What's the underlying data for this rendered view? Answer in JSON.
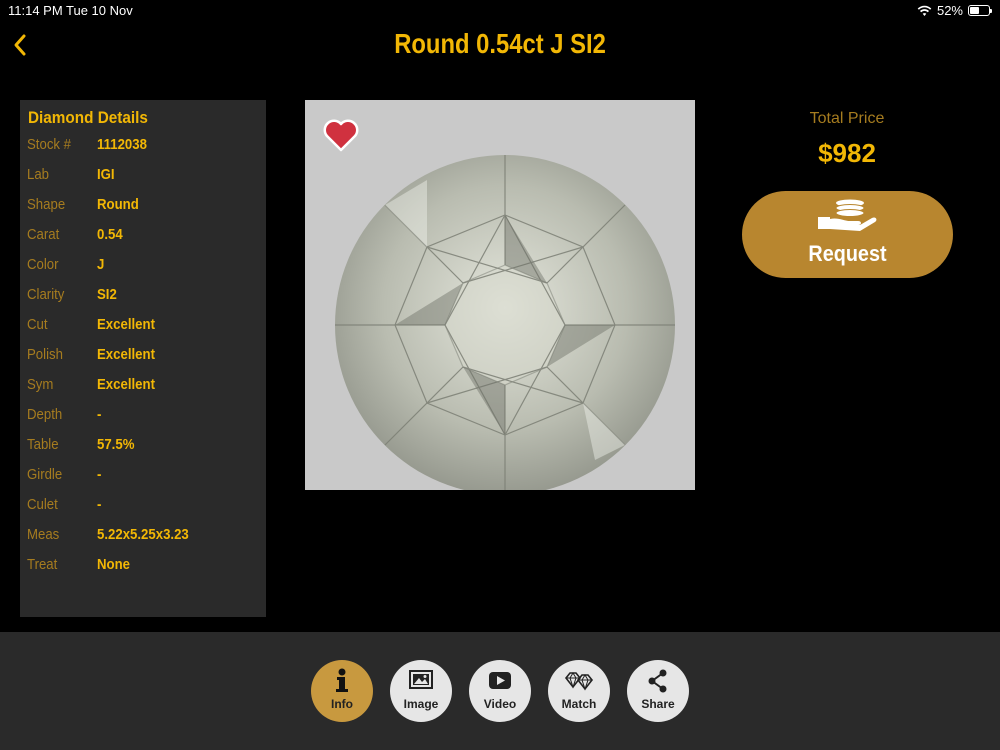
{
  "status_bar": {
    "time": "11:14 PM",
    "date": "Tue 10 Nov",
    "battery": "52%"
  },
  "header": {
    "title": "Round 0.54ct J SI2",
    "back_icon": "chevron-left-icon"
  },
  "details": {
    "title": "Diamond Details",
    "rows": [
      {
        "label": "Stock #",
        "value": "1112038"
      },
      {
        "label": "Lab",
        "value": "IGI"
      },
      {
        "label": "Shape",
        "value": "Round"
      },
      {
        "label": "Carat",
        "value": "0.54"
      },
      {
        "label": "Color",
        "value": "J"
      },
      {
        "label": "Clarity",
        "value": "SI2"
      },
      {
        "label": "Cut",
        "value": "Excellent"
      },
      {
        "label": "Polish",
        "value": "Excellent"
      },
      {
        "label": "Sym",
        "value": "Excellent"
      },
      {
        "label": "Depth",
        "value": "-"
      },
      {
        "label": "Table",
        "value": "57.5%"
      },
      {
        "label": "Girdle",
        "value": "-"
      },
      {
        "label": "Culet",
        "value": "-"
      },
      {
        "label": "Meas",
        "value": "5.22x5.25x3.23"
      },
      {
        "label": "Treat",
        "value": "None"
      }
    ]
  },
  "price": {
    "label": "Total Price",
    "value": "$982"
  },
  "request": {
    "label": "Request",
    "icon": "hand-coins-icon"
  },
  "toolbar": [
    {
      "label": "Info",
      "icon": "info-icon",
      "active": true
    },
    {
      "label": "Image",
      "icon": "image-icon",
      "active": false
    },
    {
      "label": "Video",
      "icon": "video-icon",
      "active": false
    },
    {
      "label": "Match",
      "icon": "match-diamonds-icon",
      "active": false
    },
    {
      "label": "Share",
      "icon": "share-icon",
      "active": false
    }
  ],
  "colors": {
    "accent": "#f2b705",
    "label": "#a67c1f",
    "panel": "#2a2a2a",
    "request": "#b8862f",
    "active_tool": "#c8993f",
    "heart": "#d0313f"
  }
}
